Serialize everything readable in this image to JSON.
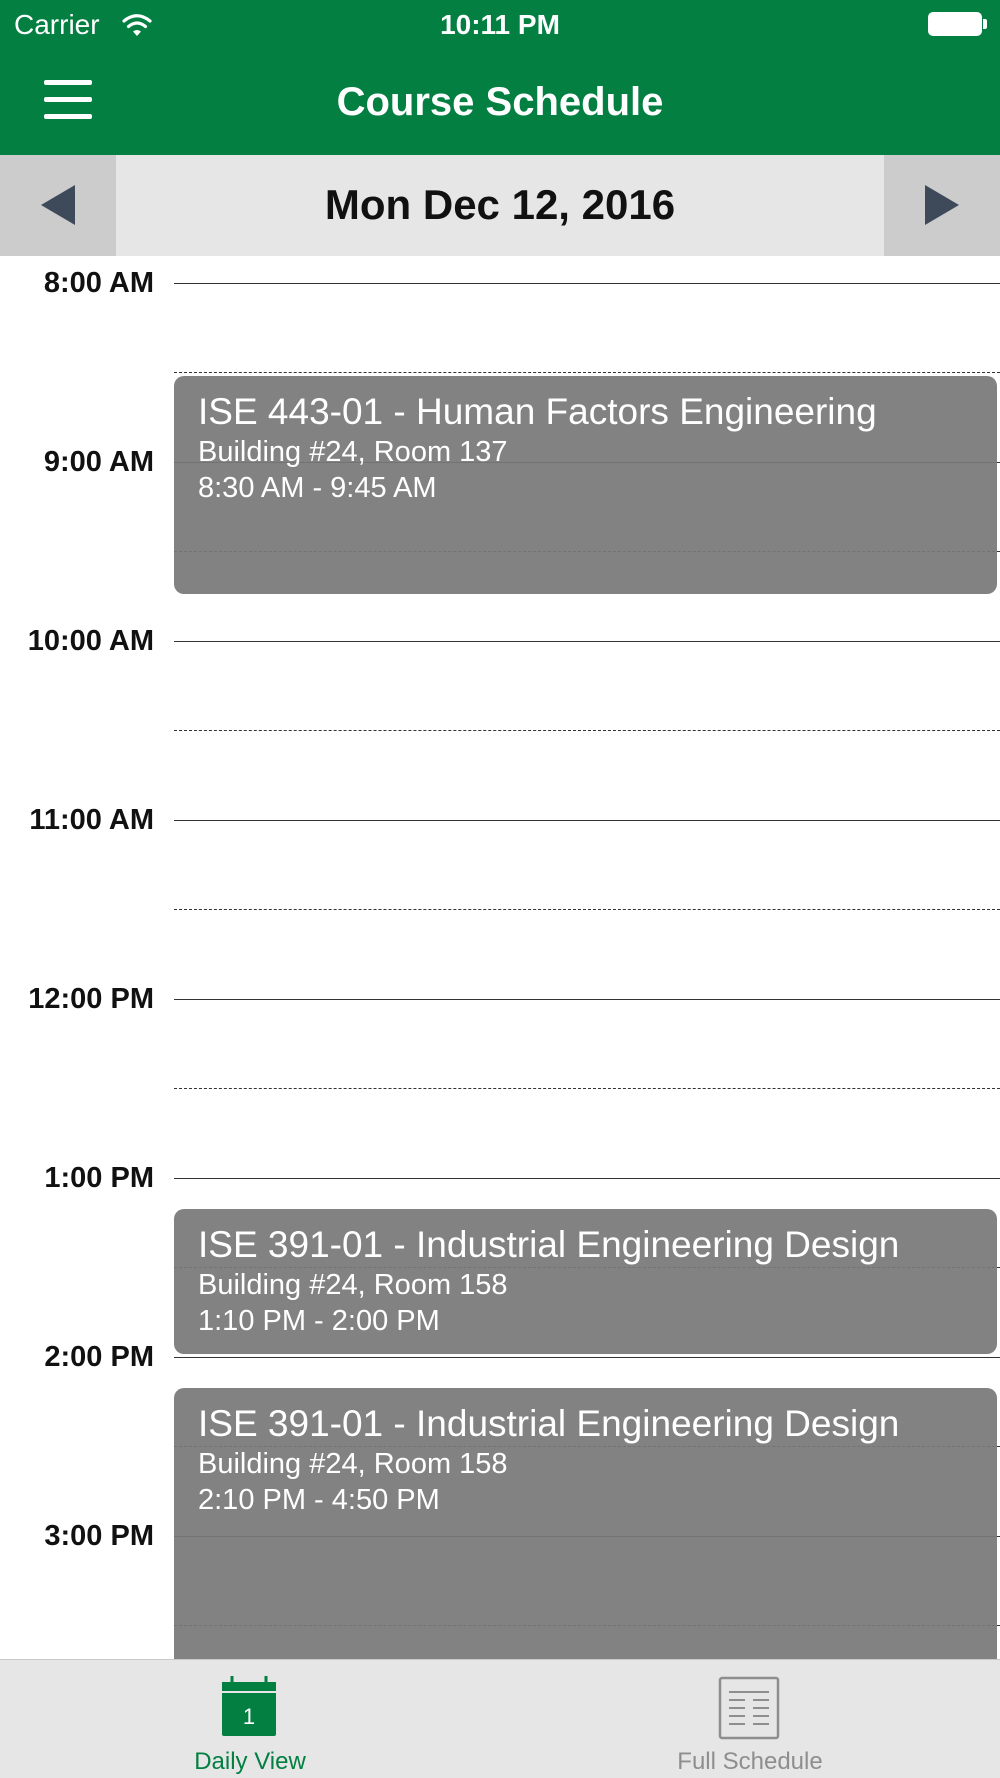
{
  "status_bar": {
    "carrier": "Carrier",
    "time": "10:11 PM"
  },
  "nav": {
    "title": "Course Schedule"
  },
  "date_bar": {
    "date": "Mon Dec 12, 2016"
  },
  "timeline": {
    "hours": [
      "8:00 AM",
      "9:00 AM",
      "10:00 AM",
      "11:00 AM",
      "12:00 PM",
      "1:00 PM",
      "2:00 PM",
      "3:00 PM"
    ],
    "events": [
      {
        "title": "ISE 443-01 - Human Factors Engineering",
        "room": "Building #24, Room 137",
        "time": "8:30 AM - 9:45 AM"
      },
      {
        "title": "ISE 391-01 - Industrial Engineering Design",
        "room": "Building #24, Room 158",
        "time": "1:10 PM - 2:00 PM"
      },
      {
        "title": "ISE 391-01 - Industrial Engineering Design",
        "room": "Building #24, Room 158",
        "time": "2:10 PM - 4:50 PM"
      }
    ]
  },
  "tabs": [
    {
      "label": "Daily View",
      "icon": "calendar-icon",
      "calendar_day": "1",
      "active": true
    },
    {
      "label": "Full Schedule",
      "icon": "list-icon",
      "active": false
    }
  ],
  "colors": {
    "brand": "#027f41",
    "event": "#7f7f7f",
    "arrow": "#3e4a59"
  }
}
